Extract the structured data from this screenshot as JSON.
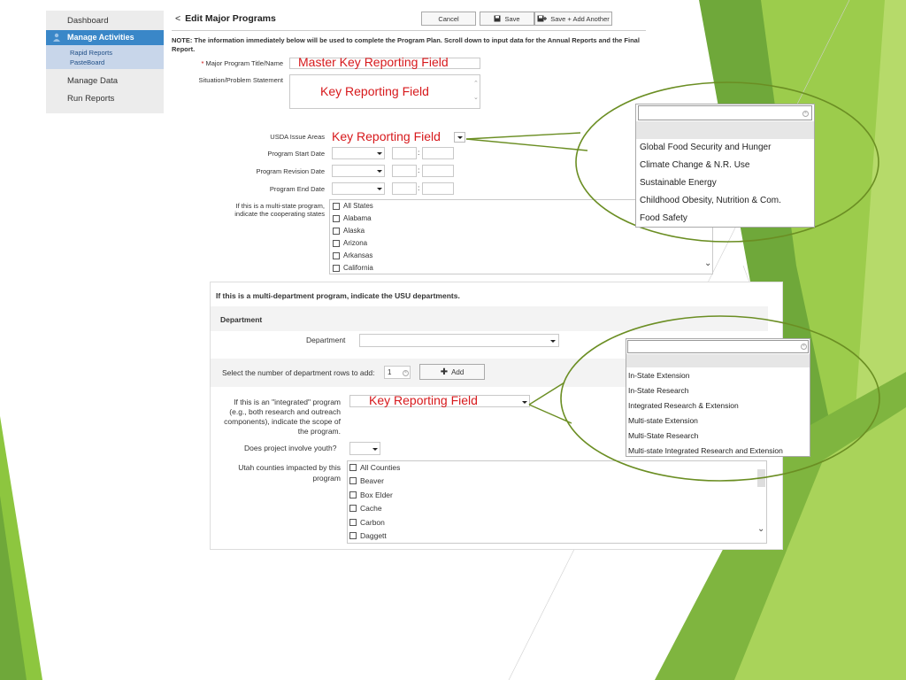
{
  "sidebar": {
    "items": [
      {
        "label": "Dashboard"
      },
      {
        "label": "Manage Activities"
      },
      {
        "label": "Rapid Reports"
      },
      {
        "label": "PasteBoard"
      },
      {
        "label": "Manage Data"
      },
      {
        "label": "Run Reports"
      }
    ]
  },
  "header": {
    "title": "Edit Major Programs",
    "cancel": "Cancel",
    "save": "Save",
    "save_add": "Save + Add Another"
  },
  "note": "NOTE: The information immediately below will be used to complete the Program Plan. Scroll down to input data for the Annual Reports and the Final Report.",
  "form": {
    "title_label": "Major Program Title/Name",
    "title_overlay": "Master Key Reporting Field",
    "situation_label": "Situation/Problem Statement",
    "situation_overlay": "Key Reporting Field",
    "usda_label": "USDA Issue Areas",
    "usda_overlay": "Key Reporting Field",
    "start_label": "Program Start Date",
    "revision_label": "Program Revision Date",
    "end_label": "Program End Date",
    "date_sep": ":",
    "multistate_label_1": "If this is a multi-state program,",
    "multistate_label_2": "indicate the cooperating states",
    "states": [
      "All States",
      "Alabama",
      "Alaska",
      "Arizona",
      "Arkansas",
      "California"
    ]
  },
  "usda_dropdown": {
    "options": [
      "Global Food Security and Hunger",
      "Climate Change & N.R. Use",
      "Sustainable Energy",
      "Childhood Obesity, Nutrition & Com.",
      "Food Safety"
    ]
  },
  "dept": {
    "panel_title": "If this is a multi-department program, indicate the USU departments.",
    "section_header": "Department",
    "dept_label": "Department",
    "rows_label": "Select the number of department rows to add:",
    "rows_value": "1",
    "add_button": "Add",
    "integrated_label": [
      "If this is an \"integrated\" program",
      "(e.g., both research and outreach",
      "components), indicate the scope of",
      "the program."
    ],
    "integrated_overlay": "Key Reporting Field",
    "youth_label": "Does project involve youth?",
    "counties_label_1": "Utah counties impacted by this",
    "counties_label_2": "program",
    "counties": [
      "All Counties",
      "Beaver",
      "Box Elder",
      "Cache",
      "Carbon",
      "Daggett"
    ]
  },
  "scope_dropdown": {
    "options": [
      "In-State Extension",
      "In-State Research",
      "Integrated Research & Extension",
      "Multi-state Extension",
      "Multi-State Research",
      "Multi-state Integrated Research and Extension"
    ]
  },
  "colors": {
    "accent_blue": "#3a87c8",
    "overlay_red": "#d7191c",
    "callout_green": "#6b8e23",
    "deco_green": "#8dc63f"
  }
}
